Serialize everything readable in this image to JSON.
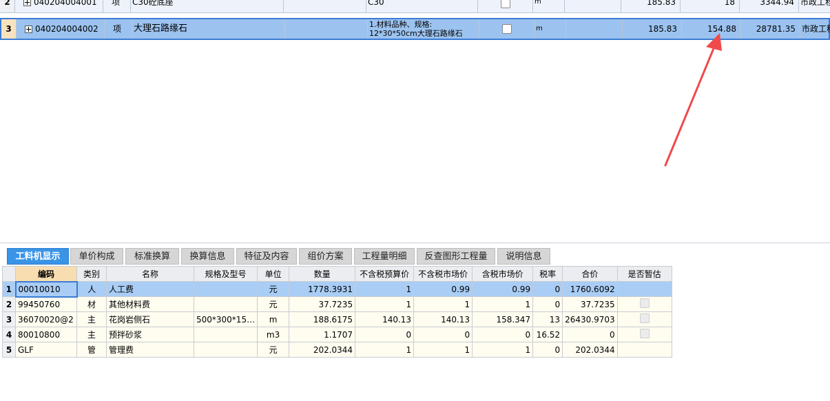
{
  "bill_rows": [
    {
      "row": "2",
      "code": "040204004001",
      "type": "项",
      "name": "C30砼底座",
      "feature": "C30",
      "unit": "m",
      "qty": "185.83",
      "price": "18",
      "total": "3344.94",
      "spec": "市政工程"
    },
    {
      "row": "3",
      "code": "040204004002",
      "type": "项",
      "name": "大理石路缘石",
      "feature_line1": "1.材料品种、规格:",
      "feature_line2": "12*30*50cm大理石路缘石",
      "unit": "m",
      "qty": "185.83",
      "price": "154.88",
      "total": "28781.35",
      "spec": "市政工程"
    }
  ],
  "tabs": [
    "工料机显示",
    "单价构成",
    "标准换算",
    "换算信息",
    "特征及内容",
    "组价方案",
    "工程量明细",
    "反查图形工程量",
    "说明信息"
  ],
  "active_tab": 0,
  "columns": [
    "编码",
    "类别",
    "名称",
    "规格及型号",
    "单位",
    "数量",
    "不含税预算价",
    "不含税市场价",
    "含税市场价",
    "税率",
    "合价",
    "是否暂估"
  ],
  "rows": [
    {
      "no": "1",
      "code": "00010010",
      "cat": "人",
      "name": "人工费",
      "spec": "",
      "unit": "元",
      "qty": "1778.3931",
      "budget": "1",
      "market": "0.99",
      "tax_market": "0.99",
      "rate": "0",
      "total": "1760.6092",
      "est": ""
    },
    {
      "no": "2",
      "code": "99450760",
      "cat": "材",
      "name": "其他材料费",
      "spec": "",
      "unit": "元",
      "qty": "37.7235",
      "budget": "1",
      "market": "1",
      "tax_market": "1",
      "rate": "0",
      "total": "37.7235",
      "est": "checkbox"
    },
    {
      "no": "3",
      "code": "36070020@2",
      "cat": "主",
      "name": "花岗岩侧石",
      "spec": "500*300*15…",
      "unit": "m",
      "qty": "188.6175",
      "budget": "140.13",
      "market": "140.13",
      "tax_market": "158.347",
      "rate": "13",
      "total": "26430.9703",
      "est": "checkbox"
    },
    {
      "no": "4",
      "code": "80010800",
      "cat": "主",
      "name": "预拌砂浆",
      "spec": "",
      "unit": "m3",
      "qty": "1.1707",
      "budget": "0",
      "market": "0",
      "tax_market": "0",
      "rate": "16.52",
      "total": "0",
      "est": "checkbox"
    },
    {
      "no": "5",
      "code": "GLF",
      "cat": "管",
      "name": "管理费",
      "spec": "",
      "unit": "元",
      "qty": "202.0344",
      "budget": "1",
      "market": "1",
      "tax_market": "1",
      "rate": "0",
      "total": "202.0344",
      "est": ""
    }
  ],
  "colors": {
    "selection": "#9cc3f0",
    "tab_active": "#3a94e6",
    "arrow": "#f04a4a"
  }
}
